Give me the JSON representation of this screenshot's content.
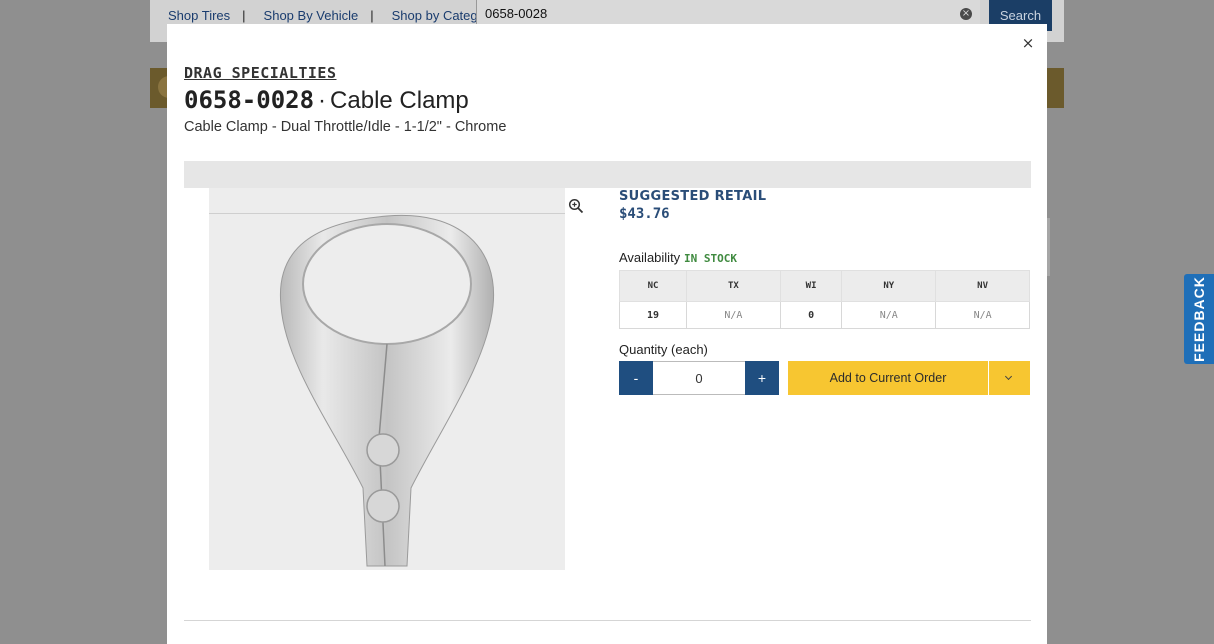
{
  "background": {
    "nav": {
      "shop_tires": "Shop Tires",
      "shop_by_vehicle": "Shop By Vehicle",
      "shop_by_category": "Shop by Category",
      "separator": "|"
    },
    "search": {
      "value": "0658-0028",
      "button_label": "Search",
      "clear_icon": "clear-circle-icon"
    },
    "feedback_label": "FEEDBACK"
  },
  "modal": {
    "close_label": "×",
    "brand": "DRAG SPECIALTIES",
    "sku": "0658-0028",
    "title_separator": "·",
    "product_name": "Cable Clamp",
    "description": "Cable Clamp - Dual Throttle/Idle - 1-1/2\" - Chrome",
    "image_alt": "Chrome dual cable clamp",
    "zoom_icon": "zoom-in-icon",
    "price": {
      "label": "SUGGESTED RETAIL",
      "value": "$43.76"
    },
    "availability": {
      "label": "Availability",
      "status": "IN STOCK"
    },
    "warehouses": {
      "headers": [
        "NC",
        "TX",
        "WI",
        "NY",
        "NV"
      ],
      "values": [
        "19",
        "N/A",
        "0",
        "N/A",
        "N/A"
      ]
    },
    "quantity": {
      "label": "Quantity (each)",
      "minus": "-",
      "plus": "+",
      "value": "0"
    },
    "add_to_order_label": "Add to Current Order"
  },
  "colors": {
    "accent_blue": "#1f4e80",
    "add_button_yellow": "#f7c631",
    "in_stock_green": "#3f8a3f",
    "feedback_blue": "#1f6fb8"
  }
}
